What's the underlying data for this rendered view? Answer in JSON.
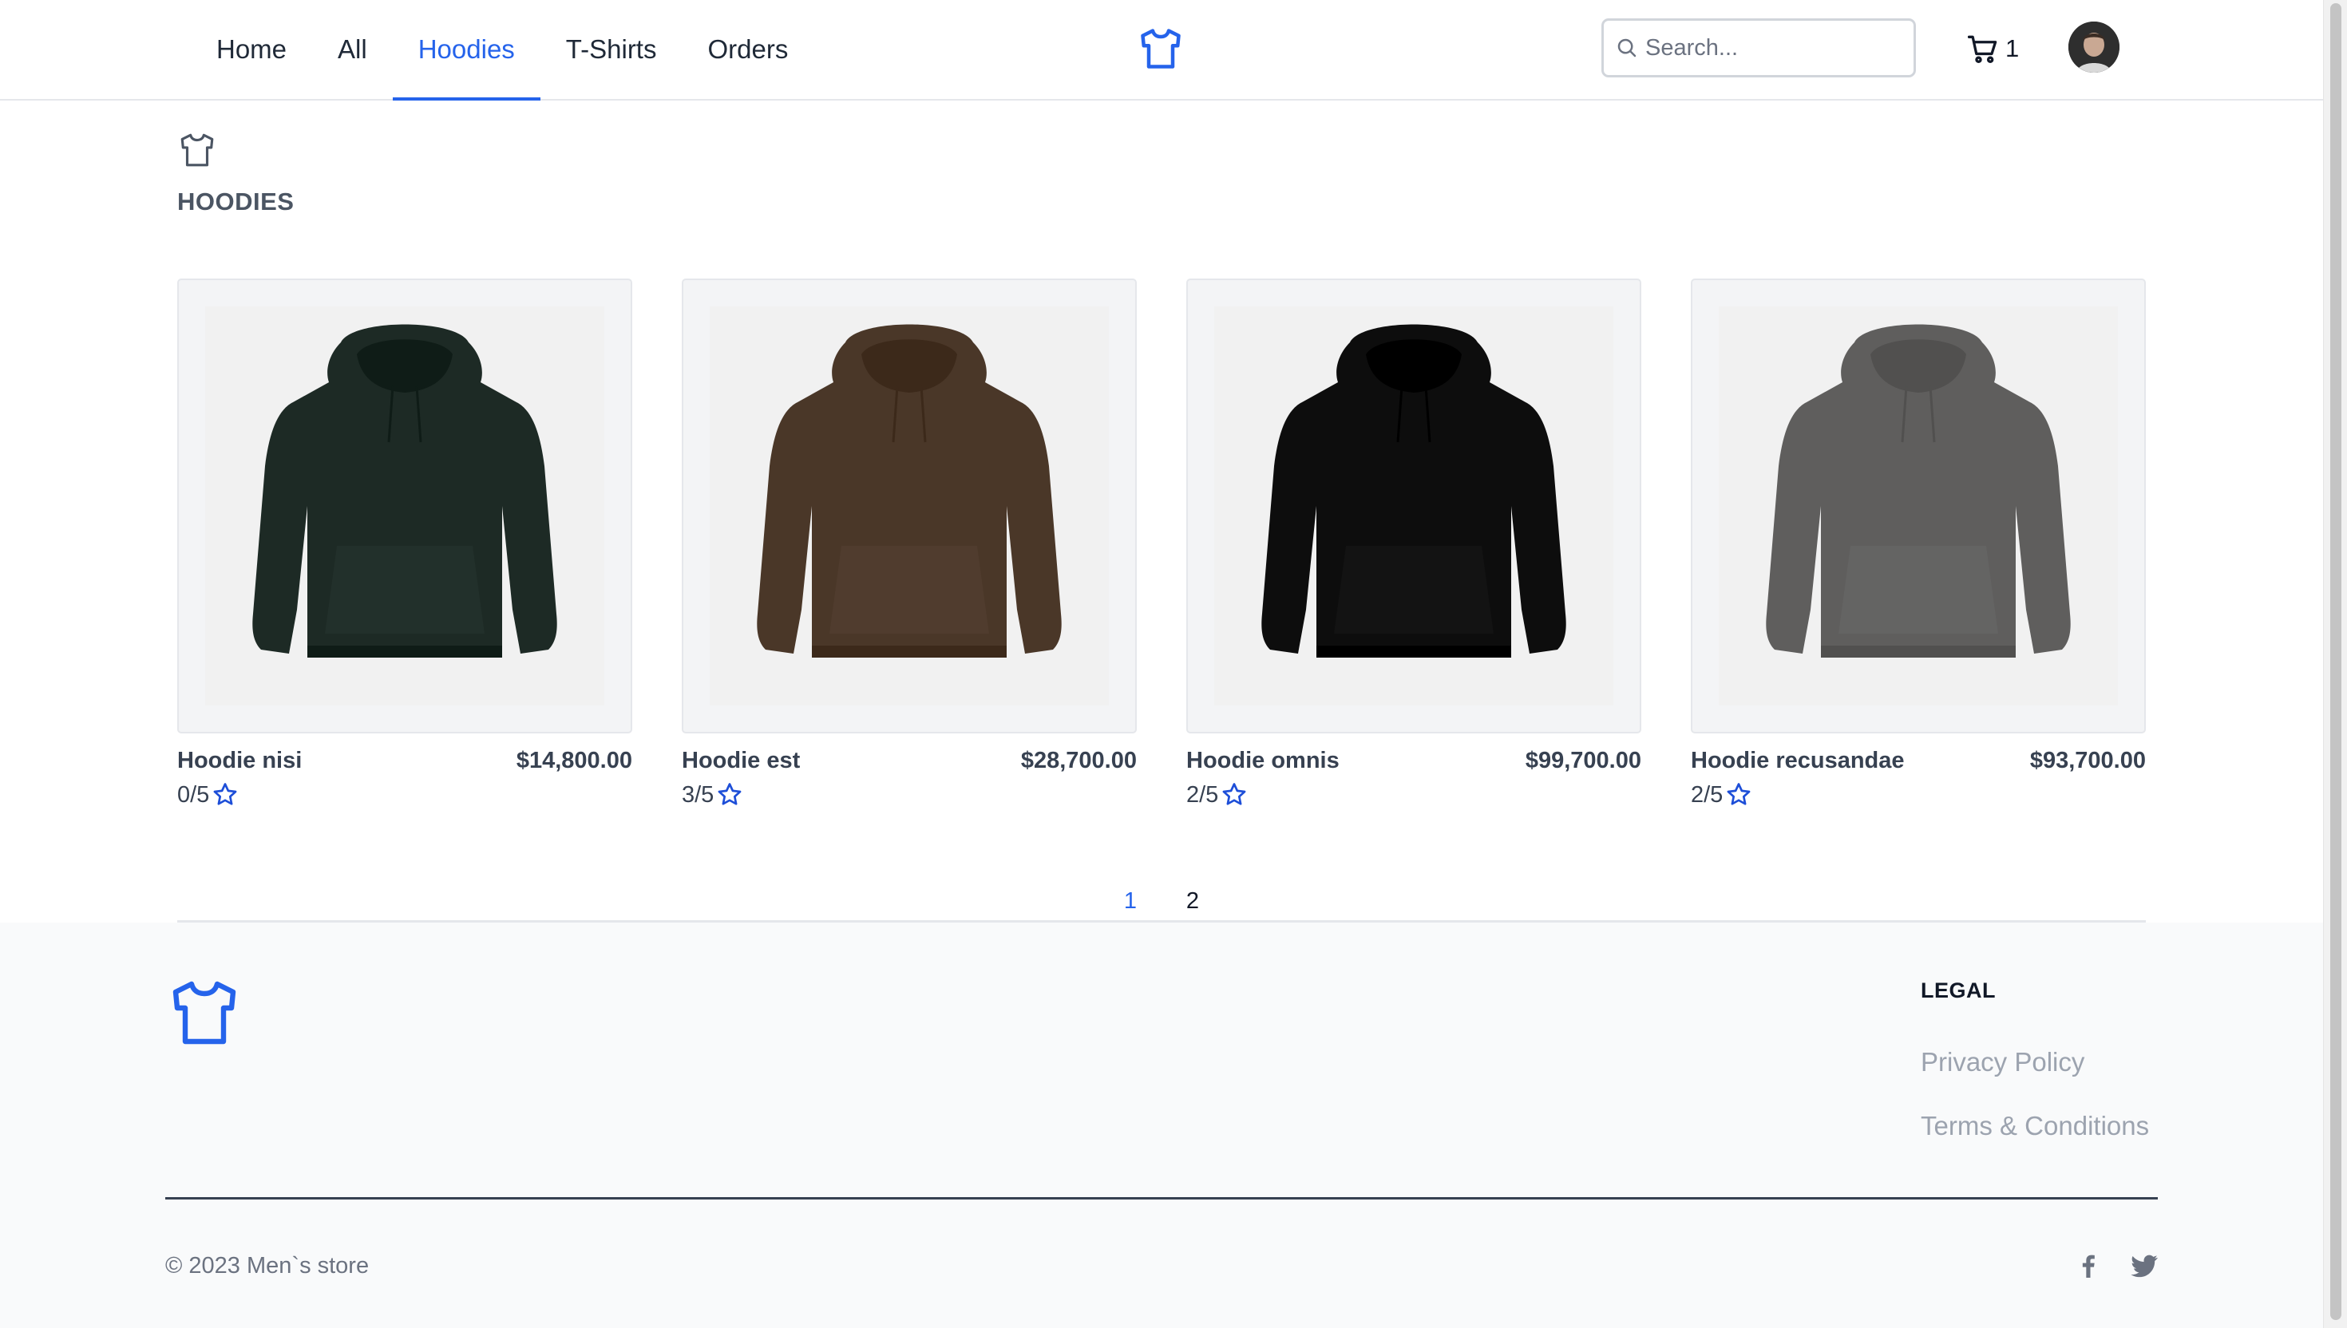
{
  "header": {
    "nav": [
      {
        "label": "Home",
        "active": false
      },
      {
        "label": "All",
        "active": false
      },
      {
        "label": "Hoodies",
        "active": true
      },
      {
        "label": "T-Shirts",
        "active": false
      },
      {
        "label": "Orders",
        "active": false
      }
    ],
    "logo_icon": "tshirt-icon",
    "search": {
      "placeholder": "Search...",
      "value": "",
      "icon": "search-icon"
    },
    "cart": {
      "icon": "cart-icon",
      "count": "1"
    },
    "avatar": "user-avatar"
  },
  "category": {
    "icon": "tshirt-icon",
    "title": "HOODIES"
  },
  "products": [
    {
      "name": "Hoodie nisi",
      "price": "$14,800.00",
      "rating": "0/5",
      "color": "#1d2a25"
    },
    {
      "name": "Hoodie est",
      "price": "$28,700.00",
      "rating": "3/5",
      "color": "#4a3728"
    },
    {
      "name": "Hoodie omnis",
      "price": "$99,700.00",
      "rating": "2/5",
      "color": "#0d0d0d"
    },
    {
      "name": "Hoodie recusandae",
      "price": "$93,700.00",
      "rating": "2/5",
      "color": "#5f5e5d"
    }
  ],
  "pagination": {
    "pages": [
      "1",
      "2"
    ],
    "current": "1"
  },
  "footer": {
    "logo_icon": "tshirt-icon",
    "legal_title": "LEGAL",
    "links": [
      "Privacy Policy",
      "Terms & Conditions"
    ],
    "copyright": "© 2023 Men`s store",
    "social": [
      "facebook-icon",
      "twitter-icon"
    ]
  },
  "colors": {
    "accent": "#2563eb",
    "text": "#1f2937",
    "muted": "#9ca3af",
    "star": "#1d4ed8"
  }
}
